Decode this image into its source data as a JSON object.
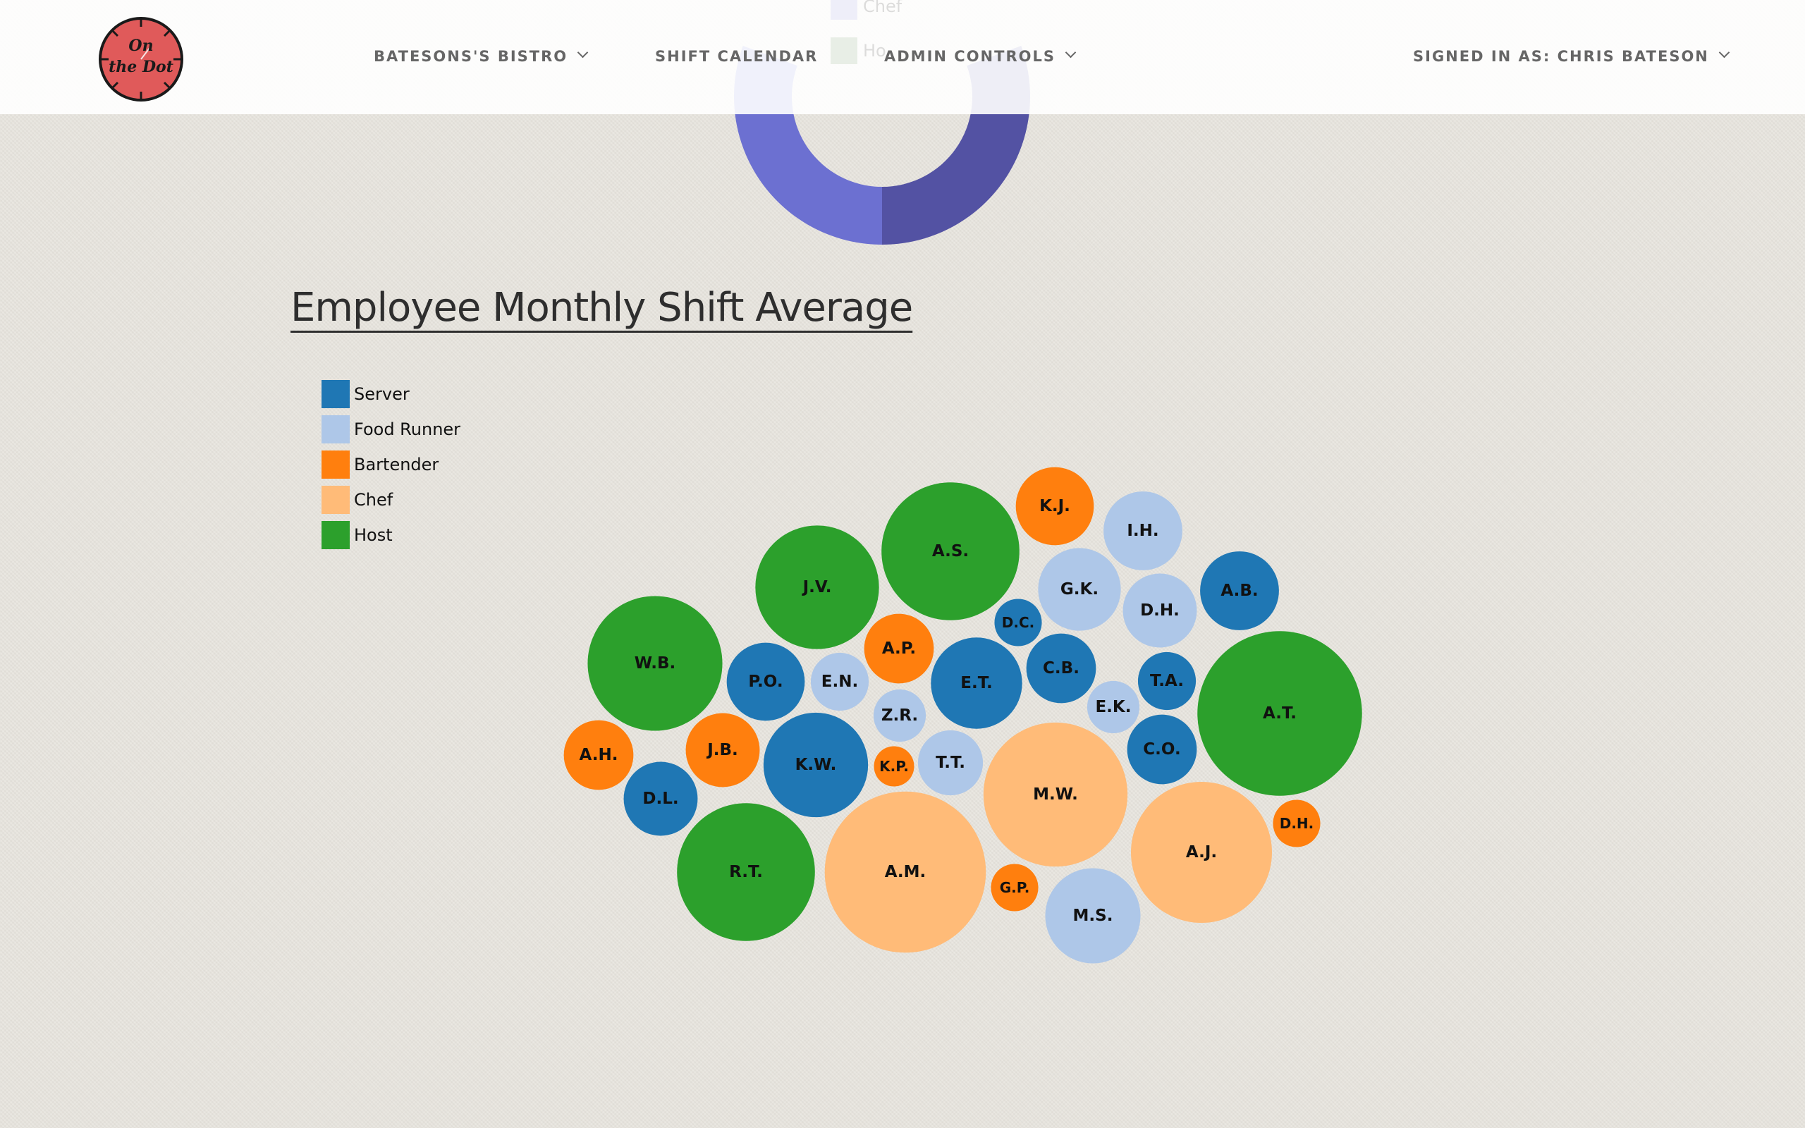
{
  "navbar": {
    "logo_text_line1": "On",
    "logo_text_line2": "the Dot",
    "logo_color": "#e05a5a",
    "items": [
      {
        "label": "BATESONS'S BISTRO",
        "has_dropdown": true
      },
      {
        "label": "SHIFT CALENDAR",
        "has_dropdown": false
      },
      {
        "label": "ADMIN CONTROLS",
        "has_dropdown": true
      },
      {
        "label": "SIGNED IN AS: CHRIS BATESON",
        "has_dropdown": true
      }
    ]
  },
  "donut_partial": {
    "colors": {
      "left_segment": "#6c70d1",
      "right_segment": "#5352a3",
      "faded_band": "#ececf7"
    },
    "ghost_legend": [
      {
        "label": "Chef",
        "color": "#eeeef9"
      },
      {
        "label": "Ho",
        "color": "#e8eee6"
      }
    ]
  },
  "section": {
    "title": "Employee Monthly Shift Average"
  },
  "legend": [
    {
      "role": "Server",
      "color": "#1f77b4"
    },
    {
      "role": "Food Runner",
      "color": "#aec7e8"
    },
    {
      "role": "Bartender",
      "color": "#ff7f0e"
    },
    {
      "role": "Chef",
      "color": "#ffbb78"
    },
    {
      "role": "Host",
      "color": "#2ca02c"
    }
  ],
  "chart_data": {
    "type": "bubble",
    "title": "Employee Monthly Shift Average",
    "color_by": "role",
    "bubbles": [
      {
        "label": "K.J.",
        "role": "Bartender",
        "value": 4.9
      },
      {
        "label": "I.H.",
        "role": "Food Runner",
        "value": 5.0
      },
      {
        "label": "A.S.",
        "role": "Host",
        "value": 15.3
      },
      {
        "label": "J.V.",
        "role": "Host",
        "value": 12.3
      },
      {
        "label": "G.K.",
        "role": "Food Runner",
        "value": 5.5
      },
      {
        "label": "D.H.",
        "role": "Food Runner",
        "value": 4.4
      },
      {
        "label": "A.B.",
        "role": "Server",
        "value": 5.0
      },
      {
        "label": "D.C.",
        "role": "Server",
        "value": 1.8
      },
      {
        "label": "W.B.",
        "role": "Host",
        "value": 14.6
      },
      {
        "label": "A.P.",
        "role": "Bartender",
        "value": 3.9
      },
      {
        "label": "P.O.",
        "role": "Server",
        "value": 4.9
      },
      {
        "label": "E.N.",
        "role": "Food Runner",
        "value": 2.7
      },
      {
        "label": "E.T.",
        "role": "Server",
        "value": 6.7
      },
      {
        "label": "C.B.",
        "role": "Server",
        "value": 3.9
      },
      {
        "label": "T.A.",
        "role": "Server",
        "value": 2.7
      },
      {
        "label": "E.K.",
        "role": "Food Runner",
        "value": 2.2
      },
      {
        "label": "Z.R.",
        "role": "Food Runner",
        "value": 2.2
      },
      {
        "label": "A.T.",
        "role": "Host",
        "value": 21.8
      },
      {
        "label": "A.H.",
        "role": "Bartender",
        "value": 3.9
      },
      {
        "label": "J.B.",
        "role": "Bartender",
        "value": 4.4
      },
      {
        "label": "K.W.",
        "role": "Server",
        "value": 8.8
      },
      {
        "label": "K.P.",
        "role": "Bartender",
        "value": 1.3
      },
      {
        "label": "T.T.",
        "role": "Food Runner",
        "value": 3.4
      },
      {
        "label": "M.W.",
        "role": "Chef",
        "value": 16.7
      },
      {
        "label": "C.O.",
        "role": "Server",
        "value": 3.9
      },
      {
        "label": "D.L.",
        "role": "Server",
        "value": 4.4
      },
      {
        "label": "D.H.",
        "role": "Bartender",
        "value": 1.8
      },
      {
        "label": "R.T.",
        "role": "Host",
        "value": 15.3
      },
      {
        "label": "A.M.",
        "role": "Chef",
        "value": 20.9
      },
      {
        "label": "G.P.",
        "role": "Bartender",
        "value": 1.8
      },
      {
        "label": "M.S.",
        "role": "Food Runner",
        "value": 7.3
      },
      {
        "label": "A.J.",
        "role": "Chef",
        "value": 16.0
      }
    ]
  }
}
